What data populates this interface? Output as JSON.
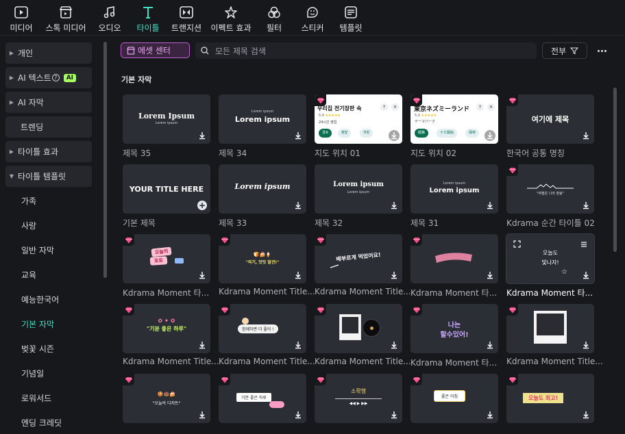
{
  "toolbar": {
    "items": [
      {
        "label": "미디어",
        "icon": "media-icon"
      },
      {
        "label": "스톡 미디어",
        "icon": "stock-media-icon"
      },
      {
        "label": "오디오",
        "icon": "audio-icon"
      },
      {
        "label": "타이틀",
        "icon": "titles-icon",
        "active": true
      },
      {
        "label": "트랜지션",
        "icon": "transitions-icon"
      },
      {
        "label": "이펙트 효과",
        "icon": "effects-icon"
      },
      {
        "label": "필터",
        "icon": "filters-icon"
      },
      {
        "label": "스티커",
        "icon": "stickers-icon"
      },
      {
        "label": "템플릿",
        "icon": "templates-icon"
      }
    ]
  },
  "sidebar": {
    "items": [
      {
        "label": "개인"
      },
      {
        "label": "AI 텍스트",
        "badge": "AI"
      },
      {
        "label": "AI 자막"
      },
      {
        "label": "트렌딩"
      },
      {
        "label": "타이틀 효과"
      },
      {
        "label": "타이틀 템플릿"
      },
      {
        "label": "가족"
      },
      {
        "label": "사랑"
      },
      {
        "label": "일반 자막"
      },
      {
        "label": "교육"
      },
      {
        "label": "예능한국어"
      },
      {
        "label": "기본 자막",
        "active": true
      },
      {
        "label": "벚꽃 시즌"
      },
      {
        "label": "기념일"
      },
      {
        "label": "로워서드"
      },
      {
        "label": "엔딩 크레딧"
      }
    ]
  },
  "topbar": {
    "asset_center": "에셋 센터",
    "search_placeholder": "모든 제목 검색",
    "filter_label": "전부"
  },
  "section": {
    "title": "기본 자막"
  },
  "cards": [
    {
      "title": "제목 35",
      "thumb": "Lorem Ipsum",
      "sub": "Lorem ipsum"
    },
    {
      "title": "제목 34",
      "thumb": "Lorem ipsum",
      "sub": "Lorem ipsum"
    },
    {
      "title": "지도 위치 01",
      "map_name": "우리집 전기장판 속",
      "map_rating": "5.0",
      "map_hours": "24시간 영업",
      "map_btn1": "경로",
      "map_btn2": "출발",
      "map_btn3": "저장"
    },
    {
      "title": "지도 위치 02",
      "map_name": "東京ネズミーランド",
      "map_rating": "5.0",
      "map_hours": "テーマパーク",
      "map_btn1": "経路",
      "map_btn2": "ナビ開始",
      "map_btn3": "保存"
    },
    {
      "title": "한국어 공통 명칭",
      "thumb": "여기에 제목"
    },
    {
      "title": "기본 제목",
      "thumb": "YOUR TITLE HERE"
    },
    {
      "title": "제목 33",
      "thumb": "Lorem ipsum"
    },
    {
      "title": "제목 32",
      "thumb": "Lorem ipsum",
      "sub": "Lorem ipsum"
    },
    {
      "title": "제목 31",
      "thumb": "Lorem ipsum",
      "sub": "Lorem ipsum"
    },
    {
      "title": "Kdrama 순간 타이틀 02",
      "thumb": "\"여행은 나의 힐링\""
    },
    {
      "title": "Kdrama Moment 타...",
      "thumb1": "오늘의",
      "thumb2": "포토"
    },
    {
      "title": "Kdrama Moment Title...",
      "thumb": "\"와기, 맛잇 발견!\""
    },
    {
      "title": "Kdrama Moment Title...",
      "thumb": "배부르게 먹었어요!"
    },
    {
      "title": "Kdrama Moment 타..."
    },
    {
      "title": "Kdrama Moment 타...",
      "thumb1": "오늘도",
      "thumb2": "빛나자!"
    },
    {
      "title": "Kdrama Moment Title...",
      "thumb": "\"기분 좋은 하루\""
    },
    {
      "title": "Kdrama Moment Title...",
      "thumb": "함께하면 더 좋아 !"
    },
    {
      "title": "Kdrama Moment Title..."
    },
    {
      "title": "Kdrama Moment 타...",
      "thumb1": "나는",
      "thumb2": "할수있어!"
    },
    {
      "title": "Kdrama Moment Title..."
    },
    {
      "title": "",
      "thumb": "\"오늘의 디저트\""
    },
    {
      "title": "",
      "thumb": "기분 좋은 하루"
    },
    {
      "title": "",
      "thumb": "소확행"
    },
    {
      "title": "",
      "thumb": "좋은 아침"
    },
    {
      "title": "",
      "thumb": "오늘도 최고!"
    }
  ],
  "colors": {
    "accent": "#3ee0c6",
    "premium_gem": "#ff4f8b",
    "asset_border": "#c05fd1",
    "card_bg": "#2b2e35"
  }
}
